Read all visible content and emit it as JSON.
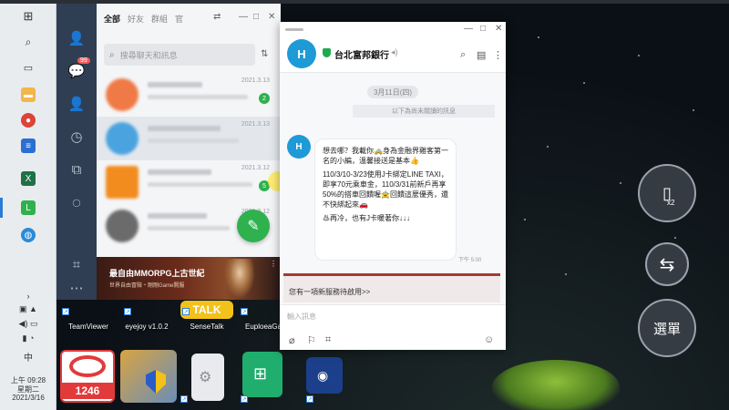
{
  "list_window": {
    "tabs": [
      "全部",
      "好友",
      "群組",
      "官"
    ],
    "search_placeholder": "搜尋聊天和訊息",
    "chats": [
      {
        "date": "2021.3.13",
        "badge": "2",
        "avatar_color": "#f07a45"
      },
      {
        "date": "2021.3.13",
        "badge": "",
        "avatar_color": "#4aa3df"
      },
      {
        "date": "2021.3.12",
        "badge": "5",
        "avatar_color": "#f28c1e"
      },
      {
        "date": "2021.3.12",
        "badge": "",
        "avatar_color": "#6b6b6b"
      }
    ],
    "ad": {
      "title": "最自由MMORPG上古世紀",
      "subtitle": "世界自由冒險・剛剛Game開服"
    }
  },
  "chat_window": {
    "bank_name": "台北富邦銀行",
    "date_pill": "3月11日(四)",
    "unread_divider": "以下為尚未閱讀的訊息",
    "message_paragraphs": [
      "想去哪？我載你🚕身為金融界雞客第一名的小編，溫馨接送是基本👍",
      "110/3/10-3/23使用J卡綁定LINE TAXI，即享70元乘車金，110/3/31前新戶再享50%的搭車回饋喔🚖回饋這麼優秀，還不快綁起來🚗",
      "♨再冷，也有J卡暖著你↓↓↓"
    ],
    "message_time": "下午 5:00",
    "promo_text": "您有一項新服務待啟用>>",
    "input_placeholder": "輸入訊息"
  },
  "desktop_icons": [
    {
      "label": "TeamViewer"
    },
    {
      "label": "eyejoy v1.0.2"
    },
    {
      "label": "SenseTalk"
    },
    {
      "label": "EuploeaGa"
    }
  ],
  "desktop_icon_texts": {
    "ace": "1246",
    "talk": "TALK"
  },
  "emulator_controls": {
    "menu_label": "選單",
    "x2_label": "x2"
  },
  "clock": {
    "time": "上午 09:28",
    "weekday": "星期二",
    "date": "2021/3/16",
    "ime": "中"
  },
  "colors": {
    "line_green": "#2fb14e",
    "bank_blue": "#1e9ad6",
    "nav_bg": "#2f3e52"
  }
}
